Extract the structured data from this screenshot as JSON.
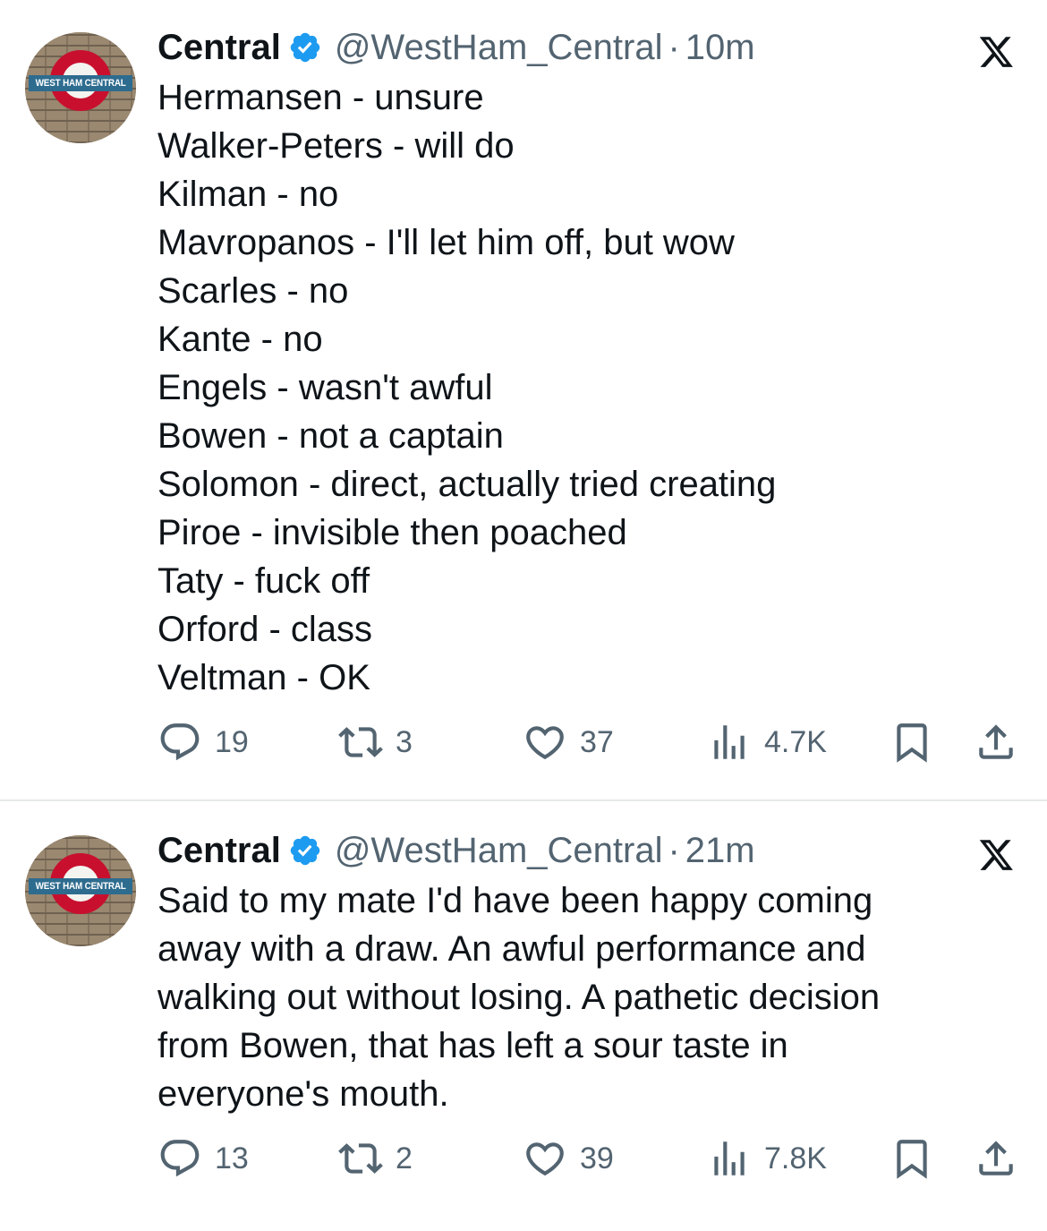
{
  "tweets": [
    {
      "author": {
        "name": "Central",
        "handle": "@WestHam_Central",
        "avatar_text": "WEST HAM CENTRAL"
      },
      "separator": "·",
      "time": "10m",
      "lines": [
        "Hermansen - unsure",
        "Walker-Peters - will do",
        "Kilman - no",
        "Mavropanos - I'll let him off, but wow",
        "Scarles - no",
        "Kante - no",
        "Engels - wasn't awful",
        "Bowen - not a captain",
        "Solomon - direct, actually tried creating",
        "Piroe - invisible then poached",
        "Taty - fuck off",
        "Orford - class",
        "Veltman - OK"
      ],
      "stats": {
        "replies": "19",
        "reposts": "3",
        "likes": "37",
        "views": "4.7K"
      }
    },
    {
      "author": {
        "name": "Central",
        "handle": "@WestHam_Central",
        "avatar_text": "WEST HAM CENTRAL"
      },
      "separator": "·",
      "time": "21m",
      "lines": [
        "Said to my mate I'd have been happy coming",
        "away with a draw. An awful performance and",
        "walking out without losing. A pathetic decision",
        "from Bowen, that has left a sour taste in",
        "everyone's mouth."
      ],
      "stats": {
        "replies": "13",
        "reposts": "2",
        "likes": "39",
        "views": "7.8K"
      }
    }
  ],
  "icons": {
    "verified": "verified-badge-icon",
    "logo": "x-logo-icon",
    "reply": "reply-icon",
    "repost": "repost-icon",
    "like": "like-icon",
    "views": "views-icon",
    "bookmark": "bookmark-icon",
    "share": "share-icon"
  },
  "colors": {
    "text": "#0f1419",
    "secondary": "#536471",
    "verified": "#1d9bf0",
    "divider": "#e7e9ea"
  }
}
